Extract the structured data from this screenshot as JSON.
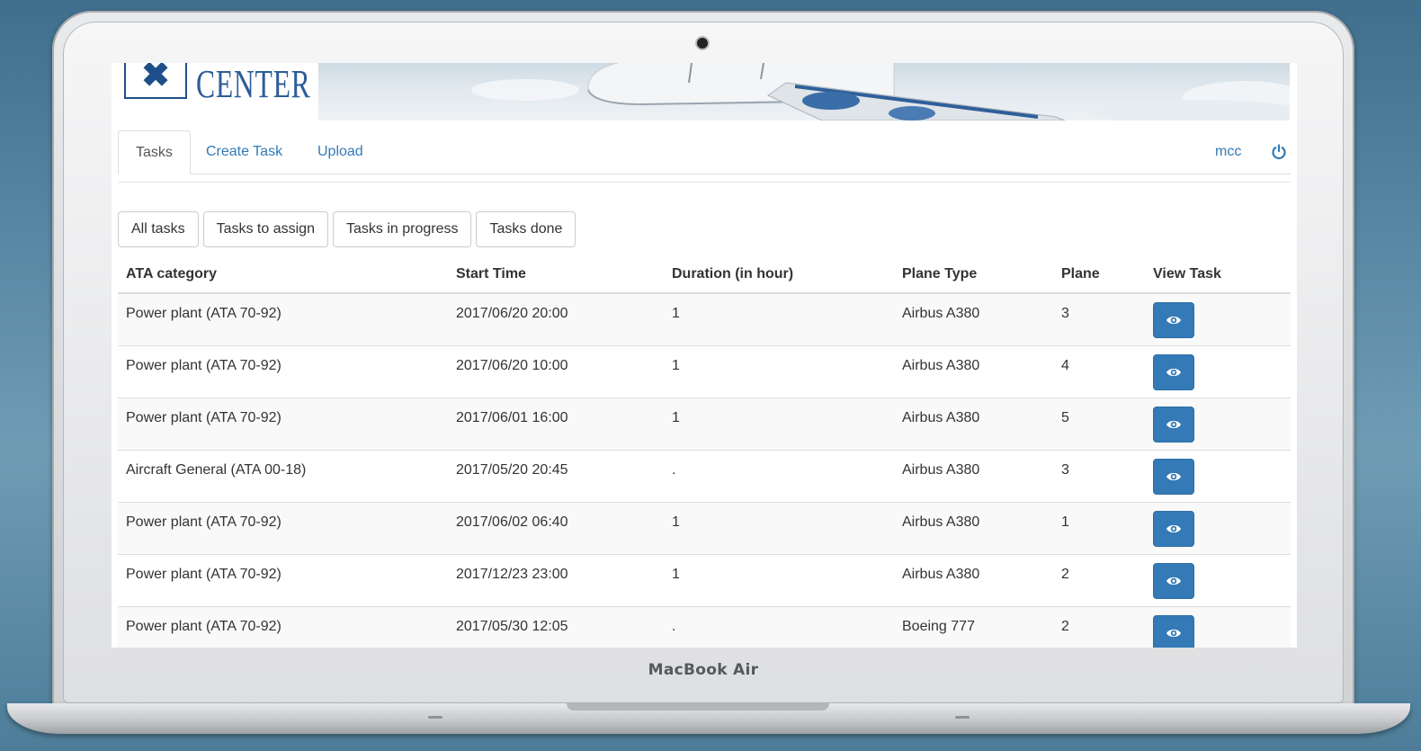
{
  "device": {
    "brand": "MacBook Air"
  },
  "banner": {
    "logo_symbol": "✖",
    "title": "CENTER"
  },
  "nav": {
    "tabs": [
      {
        "label": "Tasks",
        "active": true
      },
      {
        "label": "Create Task",
        "active": false
      },
      {
        "label": "Upload",
        "active": false
      }
    ],
    "user": "mcc",
    "logout_icon": "power-icon"
  },
  "filters": [
    "All tasks",
    "Tasks to assign",
    "Tasks in progress",
    "Tasks done"
  ],
  "table": {
    "columns": [
      "ATA category",
      "Start Time",
      "Duration (in hour)",
      "Plane Type",
      "Plane",
      "View Task"
    ],
    "rows": [
      [
        "Power plant (ATA 70-92)",
        "2017/06/20 20:00",
        "1",
        "Airbus A380",
        "3"
      ],
      [
        "Power plant (ATA 70-92)",
        "2017/06/20 10:00",
        "1",
        "Airbus A380",
        "4"
      ],
      [
        "Power plant (ATA 70-92)",
        "2017/06/01 16:00",
        "1",
        "Airbus A380",
        "5"
      ],
      [
        "Aircraft General (ATA 00-18)",
        "2017/05/20 20:45",
        ".",
        "Airbus A380",
        "3"
      ],
      [
        "Power plant (ATA 70-92)",
        "2017/06/02 06:40",
        "1",
        "Airbus A380",
        "1"
      ],
      [
        "Power plant (ATA 70-92)",
        "2017/12/23 23:00",
        "1",
        "Airbus A380",
        "2"
      ],
      [
        "Power plant (ATA 70-92)",
        "2017/05/30 12:05",
        ".",
        "Boeing 777",
        "2"
      ]
    ],
    "view_icon": "eye-icon"
  },
  "colors": {
    "link": "#337ab7",
    "primary_button": "#337ab7",
    "logo_blue": "#1f4f8a"
  }
}
